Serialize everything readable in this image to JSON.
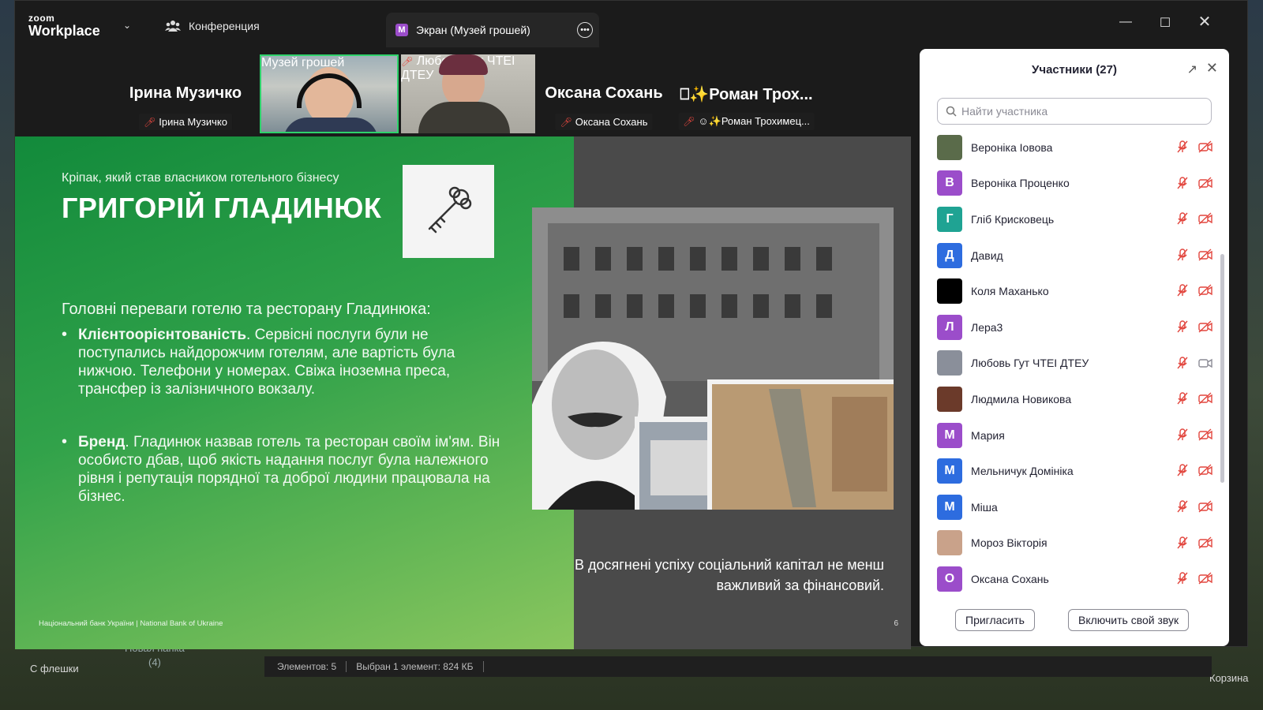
{
  "app": {
    "logo_small": "zoom",
    "logo_big": "Workplace",
    "conference_tab": "Конференция",
    "screen_tab_badge": "M",
    "screen_tab": "Экран (Музей грошей)"
  },
  "strip": [
    {
      "big_name": "Ірина Музичко",
      "caption": "Ірина Музичко",
      "muted": true,
      "video": false
    },
    {
      "caption": "Музей грошей",
      "muted": false,
      "video": true,
      "active": true
    },
    {
      "caption": "Любовь Гут ЧТЕІ ДТЕУ",
      "muted": true,
      "video": true
    },
    {
      "big_name": "Оксана Сохань",
      "caption": "Оксана Сохань",
      "muted": true,
      "video": false
    },
    {
      "big_name": "⎕✨Роман Трох...",
      "caption": "☺✨Роман Трохимец...",
      "muted": true,
      "video": false
    }
  ],
  "slide": {
    "subtitle": "Кріпак, який став власником готельного бізнесу",
    "title": "ГРИГОРІЙ ГЛАДИНЮК",
    "lead": "Головні переваги готелю та ресторану Гладинюка:",
    "bullet1_bold": "Клієнтоорієнтованість",
    "bullet1_text": ". Сервісні послуги були не поступались найдорожчим готелям, але вартість була нижчою. Телефони у номерах. Свіжа іноземна преса, трансфер із залізничного вокзалу.",
    "bullet2_bold": "Бренд",
    "bullet2_text": ". Гладинюк назвав готель та ресторан своїм ім'ям. Він особисто дбав, щоб якість надання послуг була належного рівня і репутація порядної та доброї людини працювала на бізнес.",
    "quote": "В досягнені успіху соціальний капітал не менш важливий за фінансовий.",
    "footer": "Національний банк України | National Bank of Ukraine",
    "page_num": "6"
  },
  "panel": {
    "title": "Участники (27)",
    "search_placeholder": "Найти участника",
    "invite": "Пригласить",
    "unmute": "Включить свой звук",
    "participants": [
      {
        "name": "Вероніка Іовова",
        "initial": "",
        "color": "#5a6b4a",
        "video_on": false
      },
      {
        "name": "Вероніка Проценко",
        "initial": "В",
        "color": "#9b4dca",
        "video_on": false
      },
      {
        "name": "Гліб Крисковець",
        "initial": "Г",
        "color": "#1fa393",
        "video_on": false
      },
      {
        "name": "Давид",
        "initial": "Д",
        "color": "#2d6cdf",
        "video_on": false
      },
      {
        "name": "Коля Маханько",
        "initial": "",
        "color": "#000000",
        "video_on": false
      },
      {
        "name": "Лера3",
        "initial": "Л",
        "color": "#9b4dca",
        "video_on": false
      },
      {
        "name": "Любовь Гут ЧТЕІ ДТЕУ",
        "initial": "",
        "color": "#8a8f9a",
        "video_on": true
      },
      {
        "name": "Людмила Новикова",
        "initial": "",
        "color": "#6b3a2a",
        "video_on": false
      },
      {
        "name": "Мария",
        "initial": "М",
        "color": "#9b4dca",
        "video_on": false
      },
      {
        "name": "Мельничук Домініка",
        "initial": "М",
        "color": "#2d6cdf",
        "video_on": false
      },
      {
        "name": "Міша",
        "initial": "М",
        "color": "#2d6cdf",
        "video_on": false
      },
      {
        "name": "Мороз Вікторія",
        "initial": "",
        "color": "#c9a28a",
        "video_on": false
      },
      {
        "name": "Оксана Сохань",
        "initial": "О",
        "color": "#9b4dca",
        "video_on": false
      }
    ]
  },
  "desktop": {
    "label_flash": "С флешки",
    "label_folder": "Новая папка",
    "label_folder_count": "(4)",
    "label_trash": "Корзина",
    "status_items": "Элементов: 5",
    "status_selected": "Выбран 1 элемент: 824 КБ"
  }
}
